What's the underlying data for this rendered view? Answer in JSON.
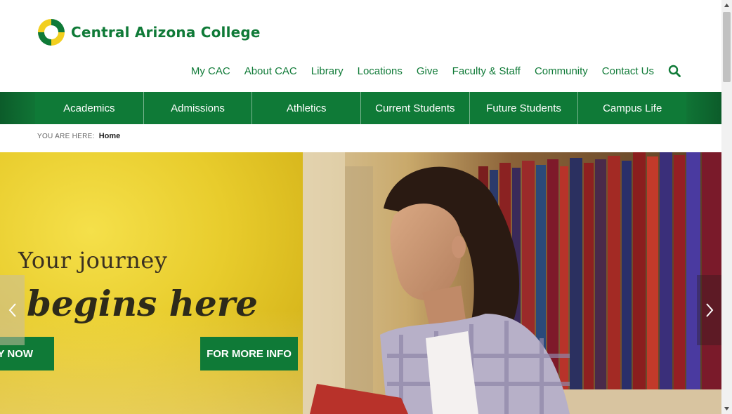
{
  "brand": {
    "name": "Central Arizona College",
    "colors": {
      "green": "#0f7a37",
      "yellow": "#f2cf1f"
    }
  },
  "utility_nav": [
    "My CAC",
    "About CAC",
    "Library",
    "Locations",
    "Give",
    "Faculty & Staff",
    "Community",
    "Contact Us"
  ],
  "main_nav": [
    "Academics",
    "Admissions",
    "Athletics",
    "Current Students",
    "Future Students",
    "Campus Life"
  ],
  "breadcrumb": {
    "label": "YOU ARE HERE:",
    "current": "Home"
  },
  "hero": {
    "line1": "Your journey",
    "line2": "begins here",
    "apply_button": "APPLY NOW",
    "info_button": "FOR MORE INFO"
  },
  "icons": {
    "search": "search-icon",
    "prev": "chevron-left-icon",
    "next": "chevron-right-icon"
  }
}
